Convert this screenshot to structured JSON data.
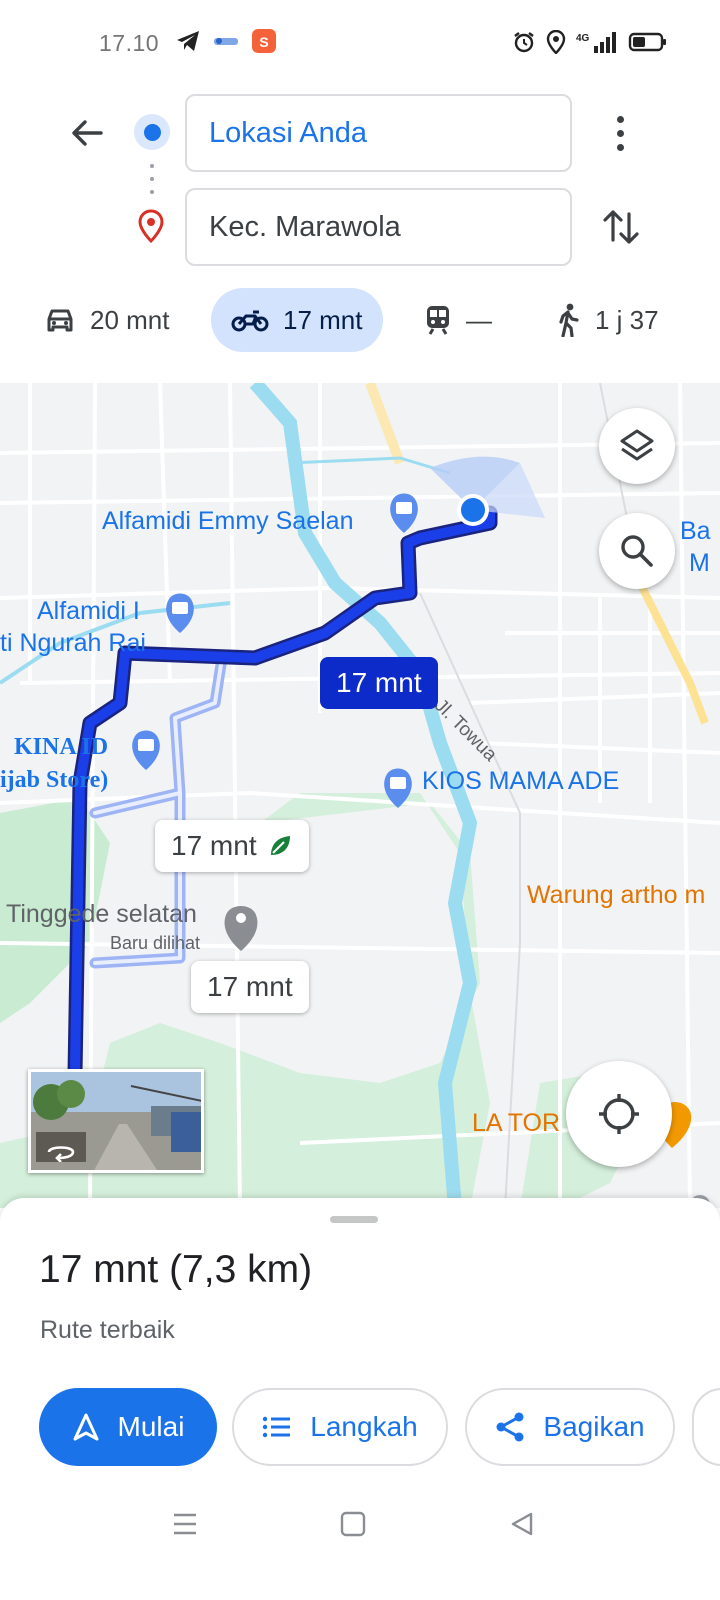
{
  "status_bar": {
    "time": "17.10",
    "network": "4G"
  },
  "directions": {
    "origin": "Lokasi Anda",
    "destination": "Kec. Marawola"
  },
  "modes": [
    {
      "name": "car",
      "label": "20 mnt",
      "icon": "car-icon"
    },
    {
      "name": "motorcycle",
      "label": "17 mnt",
      "icon": "motorcycle-icon",
      "selected": true
    },
    {
      "name": "transit",
      "label": "—",
      "icon": "train-icon"
    },
    {
      "name": "walk",
      "label": "1 j 37",
      "icon": "walk-icon"
    }
  ],
  "map": {
    "labels": {
      "alfamidi_emmy": "Alfamidi Emmy Saelan",
      "alfamidi_i": "Alfamidi I",
      "ngurah_rai": "ti Ngurah Rai",
      "kina": "KINA ID",
      "hijab": "ijab Store)",
      "towua": "Jl. Towua",
      "kios": "KIOS MAMA ADE",
      "warung": "Warung artho m",
      "tinggede": "Tinggede selatan",
      "baru_dilihat": "Baru dilihat",
      "la_tora": "LA TOR",
      "ba": "Ba",
      "m": "M"
    },
    "route_chips": {
      "selected": "17 mnt",
      "eco": "17 mnt",
      "alt": "17 mnt"
    },
    "colors": {
      "route_primary": "#1a3ee8",
      "route_alt": "#9fb4f5",
      "water": "#9cdcf0",
      "park": "#c8ebd1"
    }
  },
  "sheet": {
    "summary": "17 mnt (7,3 km)",
    "description": "Rute terbaik",
    "buttons": {
      "start": "Mulai",
      "steps": "Langkah",
      "share": "Bagikan"
    }
  }
}
